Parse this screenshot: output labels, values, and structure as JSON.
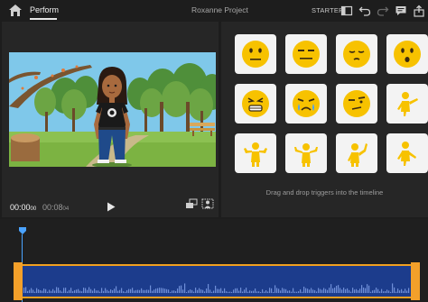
{
  "header": {
    "tab_label": "Perform",
    "project_title": "Roxanne Project",
    "starter_label": "STARTER"
  },
  "preview": {
    "current_time": "00:00",
    "current_frames": "00",
    "total_time": "00:08",
    "total_frames": "04"
  },
  "triggers": {
    "hint": "Drag and drop triggers into the timeline",
    "tiles": [
      "neutral-face-icon",
      "unamused-face-icon",
      "relieved-face-icon",
      "surprised-face-icon",
      "grimacing-face-icon",
      "crying-face-icon",
      "skeptical-face-icon",
      "pointing-pose-icon",
      "shrug-pose-icon",
      "hands-up-pose-icon",
      "wave-pose-icon",
      "point-down-pose-icon"
    ]
  },
  "colors": {
    "accent": "#4aa3ff",
    "clip": "#1c3c8c",
    "clip_border": "#f0a020",
    "emoji": "#f7c200"
  }
}
